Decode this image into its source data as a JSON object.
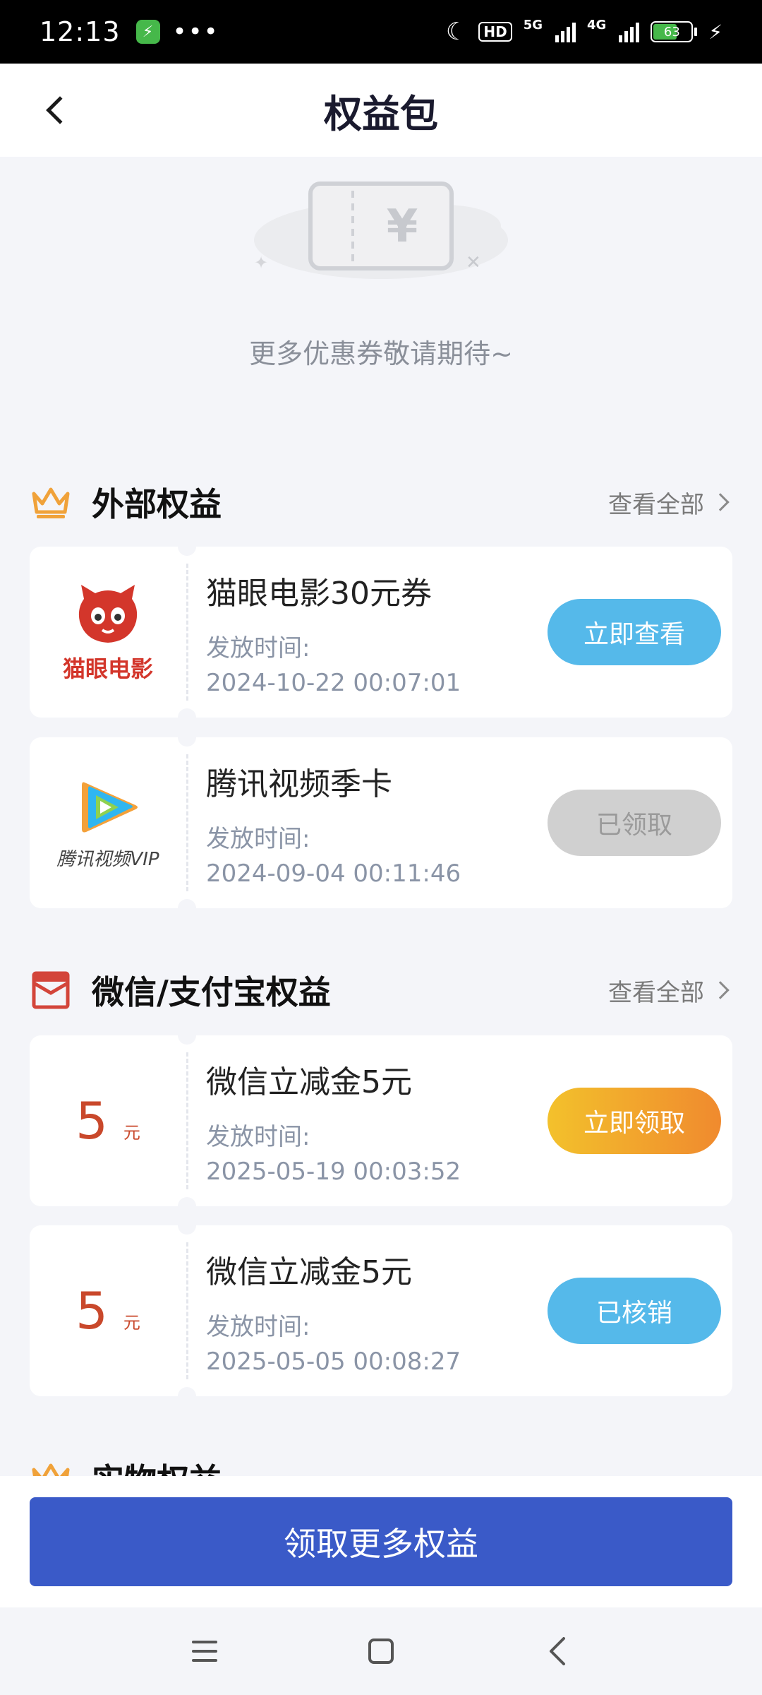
{
  "status_bar": {
    "time": "12:13",
    "dots": "•••",
    "hd_label": "HD",
    "net_5g": "5G",
    "net_4g": "4G",
    "battery_level": "63",
    "battery_fraction": 0.63
  },
  "header": {
    "title": "权益包"
  },
  "empty_state": {
    "message": "更多优惠券敬请期待~"
  },
  "sections": [
    {
      "title": "外部权益",
      "see_all": "查看全部",
      "icon": "crown-icon",
      "items": [
        {
          "brand": "猫眼电影",
          "title": "猫眼电影30元券",
          "label": "发放时间:",
          "time": "2024-10-22 00:07:01",
          "button": "立即查看",
          "button_state": "active"
        },
        {
          "brand": "腾讯视频VIP",
          "title": "腾讯视频季卡",
          "label": "发放时间:",
          "time": "2024-09-04 00:11:46",
          "button": "已领取",
          "button_state": "disabled"
        }
      ]
    },
    {
      "title": "微信/支付宝权益",
      "see_all": "查看全部",
      "icon": "red-envelope-icon",
      "items": [
        {
          "amount": "5",
          "unit": "元",
          "title": "微信立减金5元",
          "label": "发放时间:",
          "time": "2025-05-19 00:03:52",
          "button": "立即领取",
          "button_state": "highlight"
        },
        {
          "amount": "5",
          "unit": "元",
          "title": "微信立减金5元",
          "label": "发放时间:",
          "time": "2025-05-05 00:08:27",
          "button": "已核销",
          "button_state": "active"
        }
      ]
    },
    {
      "title": "实物权益",
      "icon": "crown-icon"
    }
  ],
  "footer": {
    "cta": "领取更多权益"
  },
  "colors": {
    "accent_blue": "#55b9ea",
    "cta_blue": "#3a5ac8",
    "amount_red": "#c9482b",
    "crown_orange": "#f0a23a"
  }
}
